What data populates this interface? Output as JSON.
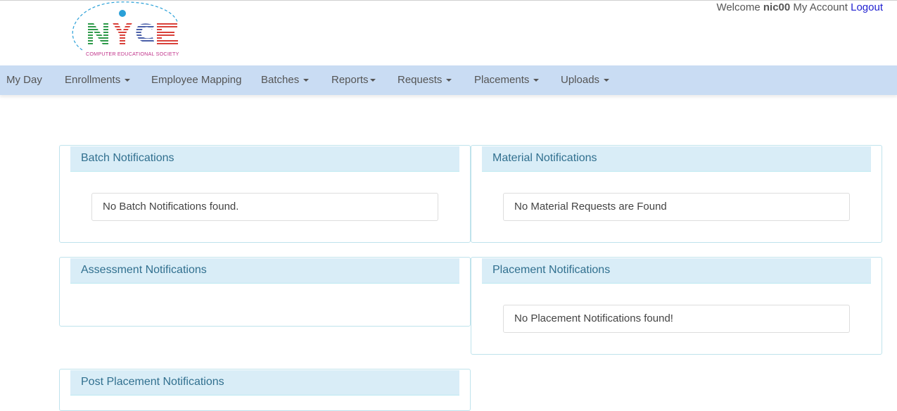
{
  "header": {
    "logo": {
      "main_text": "NICE",
      "subtitle": "COMPUTER EDUCATIONAL SOCIETY"
    },
    "welcome_prefix": "Welcome",
    "username": "nic00",
    "my_account": "My Account",
    "logout": "Logout"
  },
  "nav": {
    "items": [
      {
        "label": "My Day",
        "dropdown": false
      },
      {
        "label": "Enrollments",
        "dropdown": true
      },
      {
        "label": "Employee Mapping",
        "dropdown": false
      },
      {
        "label": "Batches",
        "dropdown": true
      },
      {
        "label": "Reports",
        "dropdown": true
      },
      {
        "label": "Requests",
        "dropdown": true
      },
      {
        "label": "Placements",
        "dropdown": true
      },
      {
        "label": "Uploads",
        "dropdown": true
      }
    ]
  },
  "panels": {
    "batch": {
      "title": "Batch Notifications",
      "message": "No Batch Notifications found."
    },
    "material": {
      "title": "Material Notifications",
      "message": "No Material Requests are Found"
    },
    "assessment": {
      "title": "Assessment Notifications"
    },
    "placement": {
      "title": "Placement Notifications",
      "message": "No Placement Notifications found!"
    },
    "post_placement": {
      "title": "Post Placement Notifications"
    }
  },
  "colors": {
    "navbar_bg": "#c9dcf3",
    "panel_heading_bg": "#d9edf7",
    "panel_heading_text": "#31708f",
    "panel_border": "#bfe3ec",
    "logout_link": "#1f1fd0",
    "logo_n": "#2e9a4a",
    "logo_c": "#4a5fa8",
    "logo_e": "#d9413a",
    "logo_dot": "#2aa0d8",
    "logo_subtitle": "#c0328a"
  }
}
